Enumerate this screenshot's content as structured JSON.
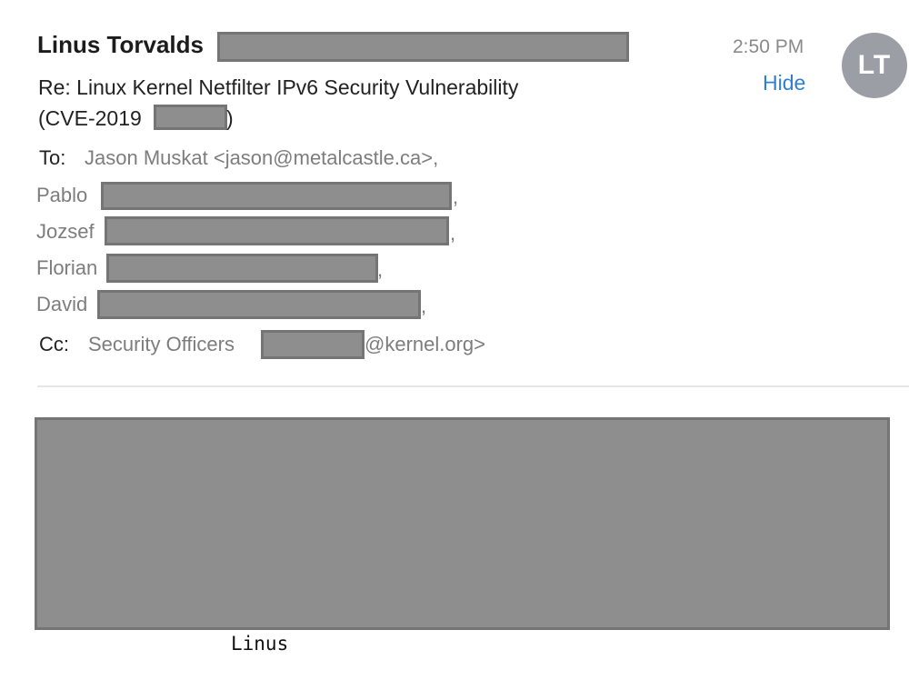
{
  "sender": {
    "name": "Linus Torvalds",
    "initials": "LT"
  },
  "time": "2:50 PM",
  "hide_label": "Hide",
  "subject": {
    "line1": "Re: Linux Kernel Netfilter IPv6 Security Vulnerability",
    "line2_prefix": "(CVE-2019",
    "line2_suffix": ")"
  },
  "to": {
    "label": "To:",
    "first": "Jason Muskat <jason@metalcastle.ca>,",
    "recipients": [
      {
        "name": "Pablo",
        "suffix": ","
      },
      {
        "name": "Jozsef",
        "suffix": ","
      },
      {
        "name": "Florian",
        "suffix": ","
      },
      {
        "name": "David",
        "suffix": ","
      }
    ]
  },
  "cc": {
    "label": "Cc:",
    "name": "Security Officers",
    "suffix": "@kernel.org>"
  },
  "signature": "Linus",
  "colors": {
    "accent": "#2f7fd2",
    "redaction": "#8e8e8e",
    "avatar": "#9b9ea5"
  }
}
